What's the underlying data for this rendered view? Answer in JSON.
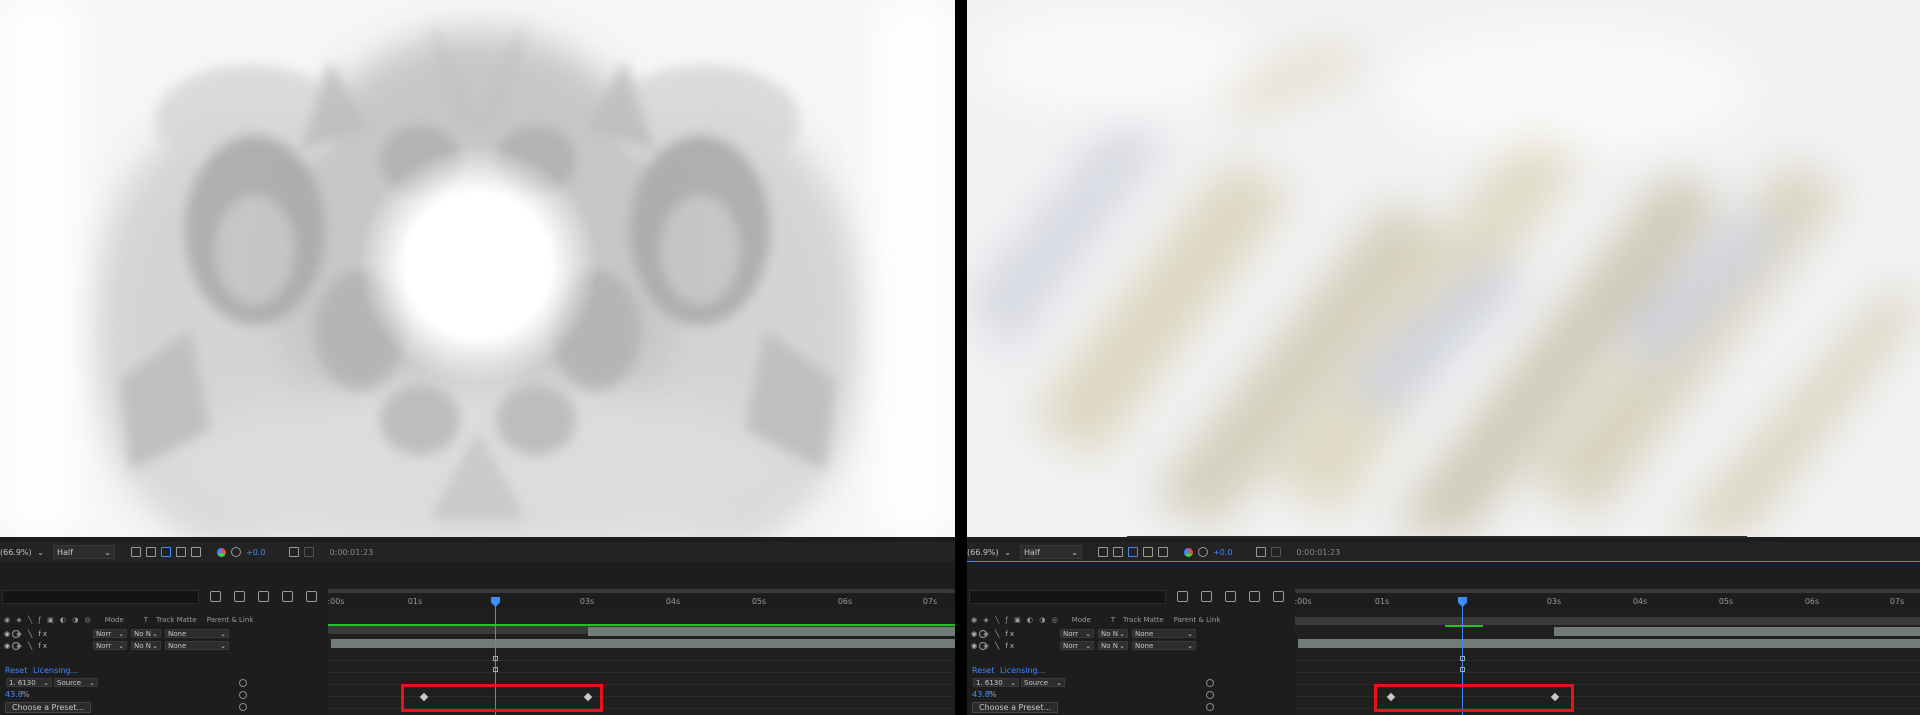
{
  "panels": [
    {
      "id": "left",
      "viewer": {
        "zoom": "(66.9%)",
        "resolution": "Half",
        "exposure": "+0.0",
        "timecode": "0:00:01:23",
        "image": "kaleidoscope-cyborg-render"
      },
      "timeline": {
        "ruler_ticks": [
          ":00s",
          "01s",
          "",
          "03s",
          "04s",
          "05s",
          "06s",
          "07s"
        ],
        "columns": {
          "mode": "Mode",
          "t": "T",
          "track_matte": "Track Matte",
          "parent": "Parent & Link"
        },
        "layers": [
          {
            "mode": "Norr",
            "matte": "No N",
            "parent": "None"
          },
          {
            "mode": "Norr",
            "matte": "No N",
            "parent": "None"
          }
        ],
        "effect": {
          "reset": "Reset",
          "licensing": "Licensing...",
          "value": "1. 6130",
          "source": "Source",
          "percent": "43.8",
          "percent_unit": "%",
          "preset_button": "Choose a Preset..."
        }
      }
    },
    {
      "id": "right",
      "viewer": {
        "zoom": "(66.9%)",
        "resolution": "Half",
        "exposure": "+0.0",
        "timecode": "0:00:01:23",
        "image": "motion-blur-render"
      },
      "timeline": {
        "ruler_ticks": [
          ":00s",
          "01s",
          "",
          "03s",
          "04s",
          "05s",
          "06s",
          "07s"
        ],
        "columns": {
          "mode": "Mode",
          "t": "T",
          "track_matte": "Track Matte",
          "parent": "Parent & Link"
        },
        "layers": [
          {
            "mode": "Norr",
            "matte": "No N",
            "parent": "None"
          },
          {
            "mode": "Norr",
            "matte": "No N",
            "parent": "None"
          }
        ],
        "effect": {
          "reset": "Reset",
          "licensing": "Licensing...",
          "value": "1. 6130",
          "source": "Source",
          "percent": "43.8",
          "percent_unit": "%",
          "preset_button": "Choose a Preset..."
        }
      }
    }
  ],
  "colors": {
    "accent_blue": "#3f8cff",
    "highlight_red": "#e8121a",
    "work_area_green": "#25c12a",
    "track_gray": "#717b78"
  }
}
